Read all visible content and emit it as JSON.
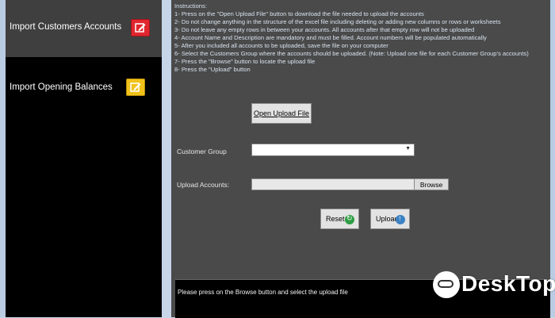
{
  "sidebar": {
    "items": [
      {
        "label": "Import Customers Accounts",
        "icon": "edit-icon",
        "icon_color": "#e1262f",
        "active": true
      },
      {
        "label": "Import Opening Balances",
        "icon": "edit-icon",
        "icon_color": "#f2c21b",
        "active": false
      }
    ]
  },
  "instructions": {
    "lines": [
      "Instructions:",
      "1- Press on the \"Open Upload File\" button to download the file needed to upload the accounts",
      "2- Do not change anything in the structure of the excel file including deleting or adding new columns or rows or worksheets",
      "3- Do not leave any empty rows in between your accounts. All accounts after that empty row will not be uploaded",
      "4- Account Name and Description are mandatory and must be filled. Account numbers will be populated automatically",
      "5- After you included all accounts to be uploaded, save the file on your computer",
      "6- Select the Customers Group where the accounts should be uploaded. (Note: Upload one file for each Customer Group's accounts)",
      "7- Press the \"Browse\" button to locate the upload file",
      "8- Press the \"Upload\" button"
    ]
  },
  "buttons": {
    "open_upload": "Open Upload File",
    "browse": "Browse",
    "reset": "Reset",
    "upload": "Upload"
  },
  "form": {
    "customer_group_label": "Customer Group",
    "customer_group_value": "",
    "upload_accounts_label": "Upload Accounts:",
    "upload_accounts_value": ""
  },
  "status": {
    "message": "Please press on the Browse button and select the upload file"
  },
  "watermark": {
    "text": "DeskTop"
  },
  "colors": {
    "main_bg": "#4a4a4a",
    "sidebar_bg": "#000000",
    "sidebar_active_bg": "#3f3f3f",
    "instruction_text": "#d7e3ef"
  }
}
